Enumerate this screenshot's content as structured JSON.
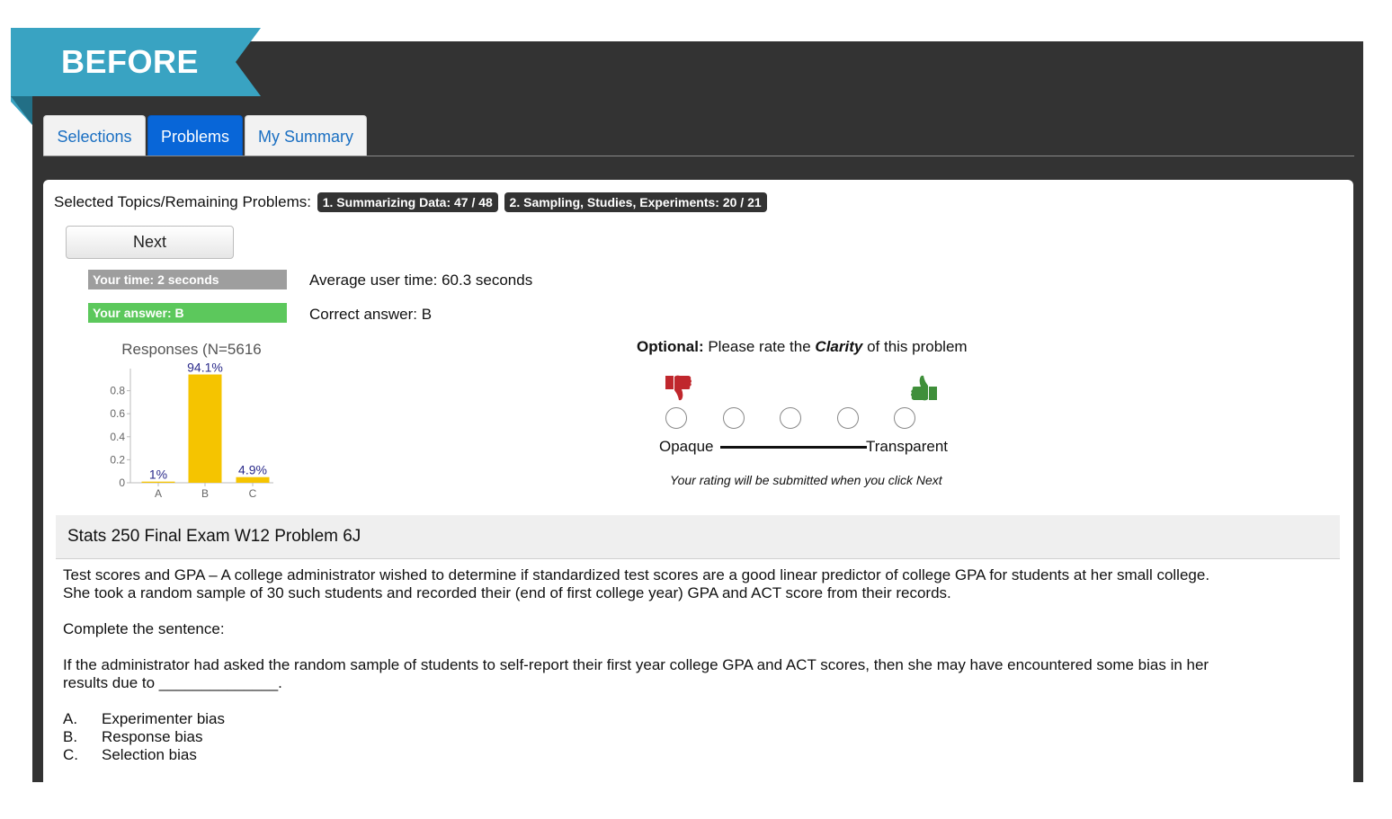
{
  "ribbon": {
    "label": "BEFORE",
    "color": "#39a3c2"
  },
  "tabs": [
    {
      "label": "Selections",
      "active": false
    },
    {
      "label": "Problems",
      "active": true
    },
    {
      "label": "My Summary",
      "active": false
    }
  ],
  "topics": {
    "label": "Selected Topics/Remaining Problems:",
    "badges": [
      "1. Summarizing Data: 47 / 48",
      "2. Sampling, Studies, Experiments: 20 / 21"
    ]
  },
  "next_button": "Next",
  "stats": {
    "your_time": "Your time:  2 seconds",
    "your_answer": "Your answer: B",
    "average_time": "Average user time: 60.3 seconds",
    "correct_answer": "Correct answer: B"
  },
  "chart_data": {
    "type": "bar",
    "title": "Responses (N=5616",
    "categories": [
      "A",
      "B",
      "C"
    ],
    "values": [
      0.01,
      0.941,
      0.049
    ],
    "data_labels": [
      "1%",
      "94.1%",
      "4.9%"
    ],
    "yticks": [
      "0",
      "0.2",
      "0.4",
      "0.6",
      "0.8"
    ],
    "ylim": [
      0,
      1
    ],
    "bar_color": "#f5c400",
    "label_color": "#2a2a8a"
  },
  "rating": {
    "prefix": "Optional:",
    "text1": " Please rate the ",
    "emphasis": "Clarity",
    "text2": " of this problem",
    "left_label": "Opaque",
    "right_label": "Transparent",
    "options": 5,
    "note": "Your rating will be submitted when you click Next",
    "thumb_down_color": "#c0272d",
    "thumb_up_color": "#3f8f3a"
  },
  "problem": {
    "title": "Stats 250 Final Exam W12 Problem 6J",
    "intro_line1": "Test scores and GPA – A college administrator wished to determine if standardized test scores are a good linear predictor of college GPA for students at her small college.",
    "intro_line2": " She took a random sample of 30 such students and recorded their (end of first college year) GPA and ACT score from their records.",
    "prompt": "Complete the sentence:",
    "question_line1": "If the administrator had asked the random sample of students to self-report their first year college GPA and ACT scores, then she may have encountered some bias in her",
    "question_line2": "results due to ______________.",
    "choices": [
      {
        "letter": "A.",
        "text": "Experimenter bias"
      },
      {
        "letter": "B.",
        "text": "Response bias"
      },
      {
        "letter": "C.",
        "text": "Selection bias"
      }
    ]
  }
}
